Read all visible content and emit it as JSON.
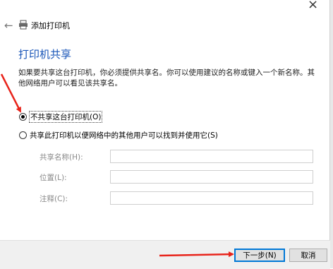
{
  "window": {
    "close_glyph": "×",
    "back_icon": "back-arrow-icon",
    "title": "添加打印机"
  },
  "main": {
    "heading": "打印机共享",
    "description": "如果要共享这台打印机，你必须提供共享名。你可以使用建议的名称或键入一个新名称。其他网络用户可以看见该共享名。",
    "options": [
      {
        "label": "不共享这台打印机(O)",
        "checked": true
      },
      {
        "label": "共享此打印机以便网络中的其他用户可以找到并使用它(S)",
        "checked": false
      }
    ],
    "fields": [
      {
        "label": "共享名称(H):",
        "value": ""
      },
      {
        "label": "位置(L):",
        "value": ""
      },
      {
        "label": "注释(C):",
        "value": ""
      }
    ]
  },
  "footer": {
    "next_label": "下一步(N)",
    "cancel_label": "取消"
  },
  "colors": {
    "heading": "#1a56b8",
    "annotation_arrow": "#e8241b",
    "primary_border": "#0078d7"
  }
}
